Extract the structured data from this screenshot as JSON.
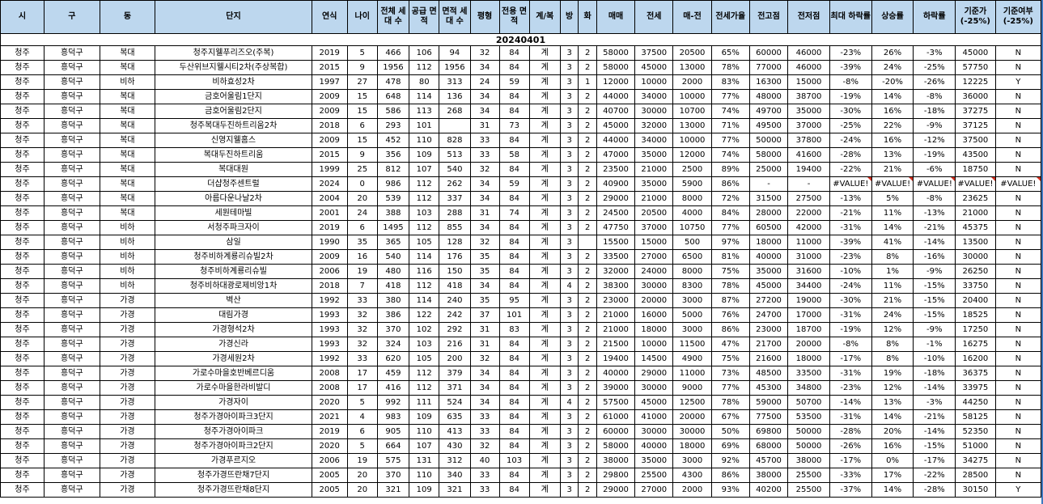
{
  "sheet": {
    "date": "20240401",
    "headers": [
      "시",
      "구",
      "동",
      "단지",
      "연식",
      "나이",
      "전체 세대 수",
      "공급 면적",
      "면적 세대 수",
      "평형",
      "전용 면적",
      "계/복",
      "방",
      "화",
      "매매",
      "전세",
      "매-전",
      "전세가율",
      "전고점",
      "전저점",
      "최대 하락률",
      "상승률",
      "하락률",
      "기준가 (-25%)",
      "기준여부 (-25%)"
    ],
    "rows": [
      [
        "청주",
        "흥덕구",
        "복대",
        "청주지웰푸리즈오(주복)",
        "2019",
        "5",
        "466",
        "106",
        "94",
        "32",
        "84",
        "계",
        "3",
        "2",
        "58000",
        "37500",
        "20500",
        "65%",
        "60000",
        "46000",
        "-23%",
        "26%",
        "-3%",
        "45000",
        "N"
      ],
      [
        "청주",
        "흥덕구",
        "복대",
        "두산위브지웰시티2차(주상복합)",
        "2015",
        "9",
        "1956",
        "112",
        "1956",
        "34",
        "84",
        "계",
        "3",
        "2",
        "58000",
        "45000",
        "13000",
        "78%",
        "77000",
        "46000",
        "-39%",
        "24%",
        "-25%",
        "57750",
        "N"
      ],
      [
        "청주",
        "흥덕구",
        "비하",
        "비하효성2차",
        "1997",
        "27",
        "478",
        "80",
        "313",
        "24",
        "59",
        "계",
        "3",
        "1",
        "12000",
        "10000",
        "2000",
        "83%",
        "16300",
        "15000",
        "-8%",
        "-20%",
        "-26%",
        "12225",
        "Y"
      ],
      [
        "청주",
        "흥덕구",
        "복대",
        "금호어울림1단지",
        "2009",
        "15",
        "648",
        "114",
        "136",
        "34",
        "84",
        "계",
        "3",
        "2",
        "44000",
        "34000",
        "10000",
        "77%",
        "48000",
        "38700",
        "-19%",
        "14%",
        "-8%",
        "36000",
        "N"
      ],
      [
        "청주",
        "흥덕구",
        "복대",
        "금호어울림2단지",
        "2009",
        "15",
        "586",
        "113",
        "268",
        "34",
        "84",
        "계",
        "3",
        "2",
        "40700",
        "30000",
        "10700",
        "74%",
        "49700",
        "35000",
        "-30%",
        "16%",
        "-18%",
        "37275",
        "N"
      ],
      [
        "청주",
        "흥덕구",
        "복대",
        "청주복대두진하트리움2차",
        "2018",
        "6",
        "293",
        "101",
        "",
        "31",
        "73",
        "계",
        "3",
        "2",
        "45000",
        "32000",
        "13000",
        "71%",
        "49500",
        "37000",
        "-25%",
        "22%",
        "-9%",
        "37125",
        "N"
      ],
      [
        "청주",
        "흥덕구",
        "복대",
        "신영지웰홈스",
        "2009",
        "15",
        "452",
        "110",
        "828",
        "33",
        "84",
        "계",
        "3",
        "2",
        "44000",
        "34000",
        "10000",
        "77%",
        "50000",
        "37800",
        "-24%",
        "16%",
        "-12%",
        "37500",
        "N"
      ],
      [
        "청주",
        "흥덕구",
        "복대",
        "복대두진하트리움",
        "2015",
        "9",
        "356",
        "109",
        "513",
        "33",
        "58",
        "계",
        "3",
        "2",
        "47000",
        "35000",
        "12000",
        "74%",
        "58000",
        "41600",
        "-28%",
        "13%",
        "-19%",
        "43500",
        "N"
      ],
      [
        "청주",
        "흥덕구",
        "복대",
        "복대대원",
        "1999",
        "25",
        "812",
        "107",
        "540",
        "32",
        "84",
        "계",
        "3",
        "2",
        "23500",
        "21000",
        "2500",
        "89%",
        "25000",
        "19400",
        "-22%",
        "21%",
        "-6%",
        "18750",
        "N"
      ],
      [
        "청주",
        "흥덕구",
        "복대",
        "더샵청주센트럴",
        "2024",
        "0",
        "986",
        "112",
        "262",
        "34",
        "59",
        "계",
        "3",
        "2",
        "40900",
        "35000",
        "5900",
        "86%",
        "-",
        "-",
        "#VALUE!",
        "#VALUE!",
        "#VALUE!",
        "#VALUE!",
        "#VALUE!"
      ],
      [
        "청주",
        "흥덕구",
        "복대",
        "아름다운나날2차",
        "2004",
        "20",
        "539",
        "112",
        "337",
        "34",
        "84",
        "계",
        "3",
        "2",
        "29000",
        "21000",
        "8000",
        "72%",
        "31500",
        "27500",
        "-13%",
        "5%",
        "-8%",
        "23625",
        "N"
      ],
      [
        "청주",
        "흥덕구",
        "복대",
        "세원테마빌",
        "2001",
        "24",
        "388",
        "103",
        "288",
        "31",
        "74",
        "계",
        "3",
        "2",
        "24500",
        "20500",
        "4000",
        "84%",
        "28000",
        "22000",
        "-21%",
        "11%",
        "-13%",
        "21000",
        "N"
      ],
      [
        "청주",
        "흥덕구",
        "비하",
        "서청주파크자이",
        "2019",
        "6",
        "1495",
        "112",
        "855",
        "34",
        "84",
        "계",
        "3",
        "2",
        "47750",
        "37000",
        "10750",
        "77%",
        "60500",
        "42000",
        "-31%",
        "14%",
        "-21%",
        "45375",
        "N"
      ],
      [
        "청주",
        "흥덕구",
        "비하",
        "삼일",
        "1990",
        "35",
        "365",
        "105",
        "128",
        "32",
        "84",
        "계",
        "3",
        "",
        "15500",
        "15000",
        "500",
        "97%",
        "18000",
        "11000",
        "-39%",
        "41%",
        "-14%",
        "13500",
        "N"
      ],
      [
        "청주",
        "흥덕구",
        "비하",
        "청주비하계룡리슈빌2차",
        "2009",
        "16",
        "540",
        "114",
        "176",
        "35",
        "84",
        "계",
        "3",
        "2",
        "33500",
        "27000",
        "6500",
        "81%",
        "40000",
        "31000",
        "-23%",
        "8%",
        "-16%",
        "30000",
        "N"
      ],
      [
        "청주",
        "흥덕구",
        "비하",
        "청주비하계룡리슈빌",
        "2006",
        "19",
        "480",
        "116",
        "150",
        "35",
        "84",
        "계",
        "3",
        "2",
        "32000",
        "24000",
        "8000",
        "75%",
        "35000",
        "31600",
        "-10%",
        "1%",
        "-9%",
        "26250",
        "N"
      ],
      [
        "청주",
        "흥덕구",
        "비하",
        "청주비하대광로제비앙1차",
        "2018",
        "7",
        "418",
        "112",
        "418",
        "34",
        "84",
        "계",
        "4",
        "2",
        "38300",
        "30000",
        "8300",
        "78%",
        "45000",
        "34400",
        "-24%",
        "11%",
        "-15%",
        "33750",
        "N"
      ],
      [
        "청주",
        "흥덕구",
        "가경",
        "벽산",
        "1992",
        "33",
        "380",
        "114",
        "240",
        "35",
        "95",
        "계",
        "3",
        "2",
        "23000",
        "20000",
        "3000",
        "87%",
        "27200",
        "19000",
        "-30%",
        "21%",
        "-15%",
        "20400",
        "N"
      ],
      [
        "청주",
        "흥덕구",
        "가경",
        "대림가경",
        "1993",
        "32",
        "386",
        "122",
        "242",
        "37",
        "101",
        "계",
        "3",
        "2",
        "21000",
        "16000",
        "5000",
        "76%",
        "24700",
        "17000",
        "-31%",
        "24%",
        "-15%",
        "18525",
        "N"
      ],
      [
        "청주",
        "흥덕구",
        "가경",
        "가경형석2차",
        "1993",
        "32",
        "370",
        "102",
        "292",
        "31",
        "83",
        "계",
        "3",
        "2",
        "21000",
        "18000",
        "3000",
        "86%",
        "23000",
        "18700",
        "-19%",
        "12%",
        "-9%",
        "17250",
        "N"
      ],
      [
        "청주",
        "흥덕구",
        "가경",
        "가경신라",
        "1993",
        "32",
        "324",
        "103",
        "216",
        "31",
        "84",
        "계",
        "3",
        "2",
        "21500",
        "10000",
        "11500",
        "47%",
        "21700",
        "20000",
        "-8%",
        "8%",
        "-1%",
        "16275",
        "N"
      ],
      [
        "청주",
        "흥덕구",
        "가경",
        "가경세원2차",
        "1992",
        "33",
        "620",
        "105",
        "200",
        "32",
        "84",
        "계",
        "3",
        "2",
        "19400",
        "14500",
        "4900",
        "75%",
        "21600",
        "18000",
        "-17%",
        "8%",
        "-10%",
        "16200",
        "N"
      ],
      [
        "청주",
        "흥덕구",
        "가경",
        "가로수마을호반베르디움",
        "2008",
        "17",
        "459",
        "112",
        "379",
        "34",
        "84",
        "계",
        "3",
        "2",
        "40000",
        "29000",
        "11000",
        "73%",
        "48500",
        "33500",
        "-31%",
        "19%",
        "-18%",
        "36375",
        "N"
      ],
      [
        "청주",
        "흥덕구",
        "가경",
        "가로수마을한라비발디",
        "2008",
        "17",
        "416",
        "112",
        "371",
        "34",
        "84",
        "계",
        "3",
        "2",
        "39000",
        "30000",
        "9000",
        "77%",
        "45300",
        "34800",
        "-23%",
        "12%",
        "-14%",
        "33975",
        "N"
      ],
      [
        "청주",
        "흥덕구",
        "가경",
        "가경자이",
        "2020",
        "5",
        "992",
        "111",
        "524",
        "34",
        "84",
        "계",
        "4",
        "2",
        "57500",
        "45000",
        "12500",
        "78%",
        "59000",
        "50700",
        "-14%",
        "13%",
        "-3%",
        "44250",
        "N"
      ],
      [
        "청주",
        "흥덕구",
        "가경",
        "청주가경아이파크3단지",
        "2021",
        "4",
        "983",
        "109",
        "635",
        "33",
        "84",
        "계",
        "3",
        "2",
        "61000",
        "41000",
        "20000",
        "67%",
        "77500",
        "53500",
        "-31%",
        "14%",
        "-21%",
        "58125",
        "N"
      ],
      [
        "청주",
        "흥덕구",
        "가경",
        "청주가경아이파크",
        "2019",
        "6",
        "905",
        "110",
        "413",
        "33",
        "84",
        "계",
        "3",
        "2",
        "60000",
        "30000",
        "30000",
        "50%",
        "69800",
        "50000",
        "-28%",
        "20%",
        "-14%",
        "52350",
        "N"
      ],
      [
        "청주",
        "흥덕구",
        "가경",
        "청주가경아이파크2단지",
        "2020",
        "5",
        "664",
        "107",
        "430",
        "32",
        "84",
        "계",
        "3",
        "2",
        "58000",
        "40000",
        "18000",
        "69%",
        "68000",
        "50000",
        "-26%",
        "16%",
        "-15%",
        "51000",
        "N"
      ],
      [
        "청주",
        "흥덕구",
        "가경",
        "가경푸르지오",
        "2006",
        "19",
        "575",
        "131",
        "312",
        "40",
        "103",
        "계",
        "3",
        "2",
        "38000",
        "35000",
        "3000",
        "92%",
        "45700",
        "38000",
        "-17%",
        "0%",
        "-17%",
        "34275",
        "N"
      ],
      [
        "청주",
        "흥덕구",
        "가경",
        "청주가경뜨란채7단지",
        "2005",
        "20",
        "370",
        "110",
        "340",
        "33",
        "84",
        "계",
        "3",
        "2",
        "29800",
        "25500",
        "4300",
        "86%",
        "38000",
        "25500",
        "-33%",
        "17%",
        "-22%",
        "28500",
        "N"
      ],
      [
        "청주",
        "흥덕구",
        "가경",
        "청주가경뜨란채8단지",
        "2005",
        "20",
        "321",
        "109",
        "321",
        "33",
        "84",
        "계",
        "3",
        "2",
        "29000",
        "27000",
        "2000",
        "93%",
        "40200",
        "25500",
        "-37%",
        "14%",
        "-28%",
        "30150",
        "Y"
      ]
    ]
  }
}
